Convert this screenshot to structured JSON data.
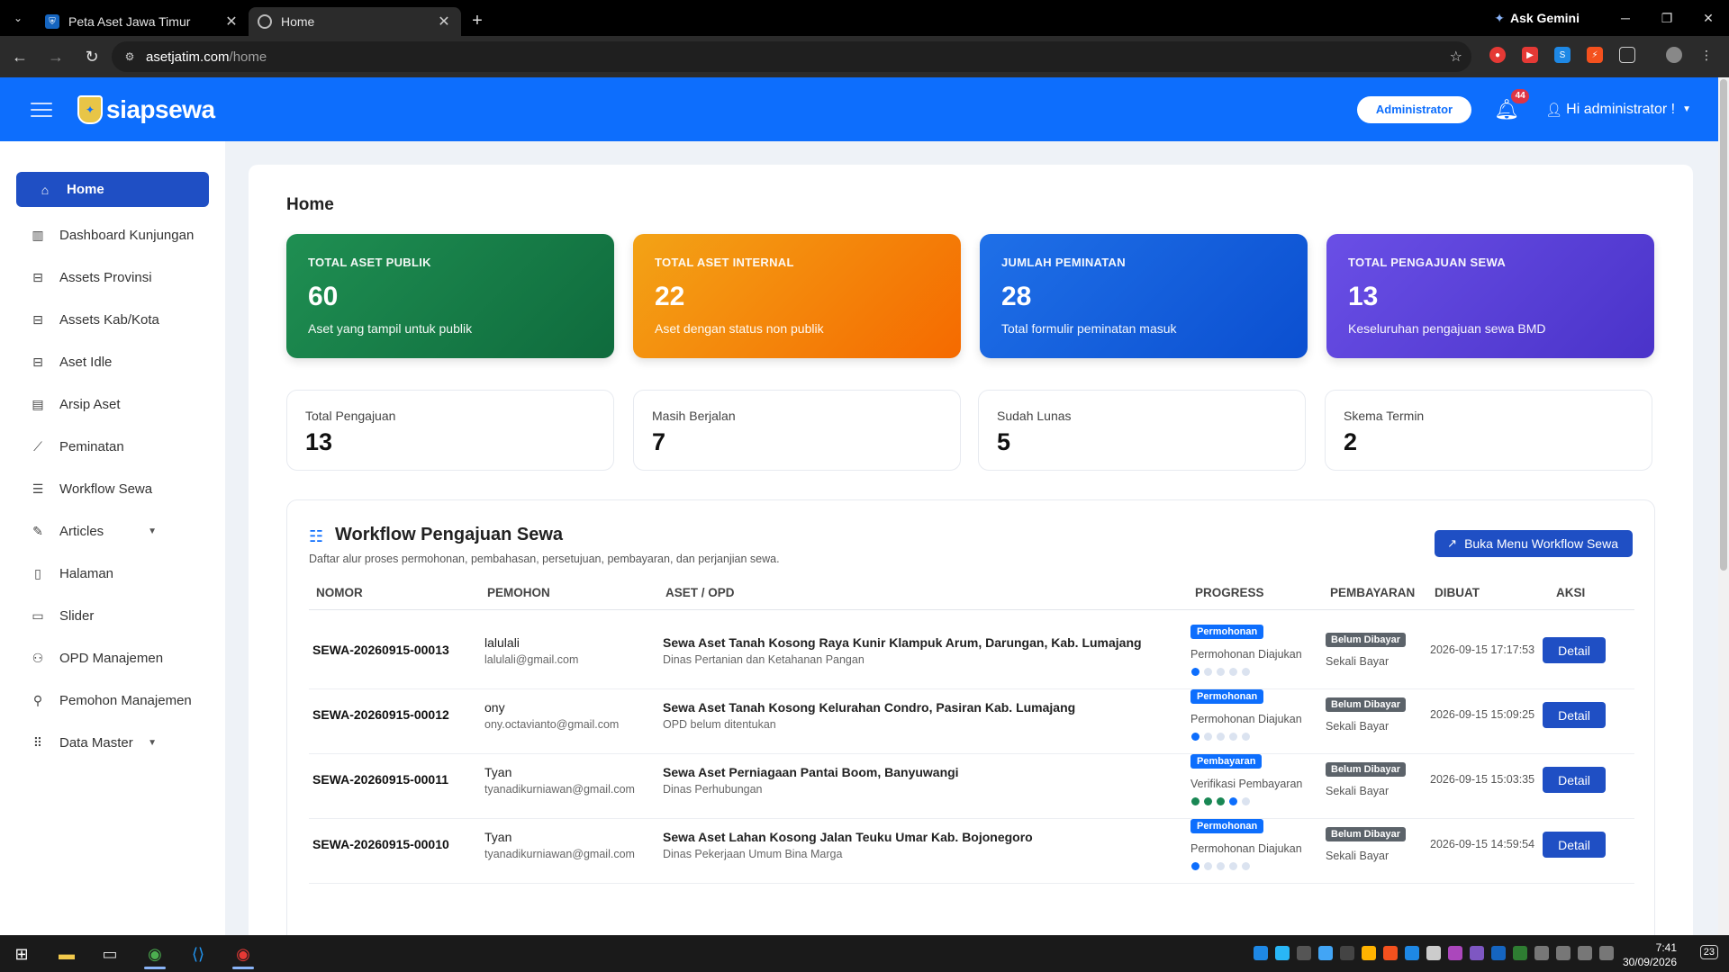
{
  "browser": {
    "tabs": [
      {
        "title": "Peta Aset Jawa Timur",
        "active": false
      },
      {
        "title": "Home",
        "active": true
      }
    ],
    "gemini_label": "Ask Gemini",
    "url_host": "asetjatim.com",
    "url_path": "/home"
  },
  "header": {
    "logo_text": "siapsewa",
    "role_pill": "Administrator",
    "notification_count": "44",
    "user_greeting": "Hi administrator !"
  },
  "sidebar": {
    "items": [
      {
        "label": "Home",
        "icon": "home-icon",
        "active": true
      },
      {
        "label": "Dashboard Kunjungan",
        "icon": "bar-chart-icon"
      },
      {
        "label": "Assets Provinsi",
        "icon": "box-icon"
      },
      {
        "label": "Assets Kab/Kota",
        "icon": "box-icon"
      },
      {
        "label": "Aset Idle",
        "icon": "box-icon"
      },
      {
        "label": "Arsip Aset",
        "icon": "archive-icon"
      },
      {
        "label": "Peminatan",
        "icon": "trend-icon"
      },
      {
        "label": "Workflow Sewa",
        "icon": "list-icon"
      },
      {
        "label": "Articles",
        "icon": "edit-icon",
        "has_submenu": true
      },
      {
        "label": "Halaman",
        "icon": "page-icon"
      },
      {
        "label": "Slider",
        "icon": "slider-icon"
      },
      {
        "label": "OPD Manajemen",
        "icon": "group-icon"
      },
      {
        "label": "Pemohon Manajemen",
        "icon": "user-icon"
      },
      {
        "label": "Data Master",
        "icon": "grid-icon",
        "has_submenu": true
      }
    ]
  },
  "main": {
    "title": "Home",
    "stat_cards": [
      {
        "label": "TOTAL ASET PUBLIK",
        "value": "60",
        "desc": "Aset yang tampil untuk publik",
        "color": "#1f8f52"
      },
      {
        "label": "TOTAL ASET INTERNAL",
        "value": "22",
        "desc": "Aset dengan status non publik",
        "color": "#f38a0c"
      },
      {
        "label": "JUMLAH PEMINATAN",
        "value": "28",
        "desc": "Total formulir peminatan masuk",
        "color": "#1560e0"
      },
      {
        "label": "TOTAL PENGAJUAN SEWA",
        "value": "13",
        "desc": "Keseluruhan pengajuan sewa BMD",
        "color": "#5a40d8"
      }
    ],
    "mini_cards": [
      {
        "label": "Total Pengajuan",
        "value": "13"
      },
      {
        "label": "Masih Berjalan",
        "value": "7"
      },
      {
        "label": "Sudah Lunas",
        "value": "5"
      },
      {
        "label": "Skema Termin",
        "value": "2"
      }
    ],
    "workflow": {
      "title": "Workflow Pengajuan Sewa",
      "subtitle": "Daftar alur proses permohonan, pembahasan, persetujuan, pembayaran, dan perjanjian sewa.",
      "button_label": "Buka Menu Workflow Sewa",
      "columns": [
        "NOMOR",
        "PEMOHON",
        "ASET / OPD",
        "PROGRESS",
        "PEMBAYARAN",
        "DIBUAT",
        "AKSI"
      ],
      "rows": [
        {
          "nomor": "SEWA-20260915-00013",
          "pemohon": "lalulali",
          "email": "lalulali@gmail.com",
          "aset": "Sewa Aset Tanah Kosong Raya Kunir Klampuk Arum, Darungan, Kab. Lumajang",
          "opd": "Dinas Pertanian dan Ketahanan Pangan",
          "stage": "Permohonan",
          "status": "Permohonan Diajukan",
          "progress_step": 1,
          "payment": "Belum Dibayar",
          "scheme": "Sekali Bayar",
          "created": "2026-09-15 17:17:53",
          "action": "Detail"
        },
        {
          "nomor": "SEWA-20260915-00012",
          "pemohon": "ony",
          "email": "ony.octavianto@gmail.com",
          "aset": "Sewa Aset Tanah Kosong Kelurahan Condro, Pasiran Kab. Lumajang",
          "opd": "OPD belum ditentukan",
          "stage": "Permohonan",
          "status": "Permohonan Diajukan",
          "progress_step": 1,
          "payment": "Belum Dibayar",
          "scheme": "Sekali Bayar",
          "created": "2026-09-15 15:09:25",
          "action": "Detail"
        },
        {
          "nomor": "SEWA-20260915-00011",
          "pemohon": "Tyan",
          "email": "tyanadikurniawan@gmail.com",
          "aset": "Sewa Aset Perniagaan Pantai Boom, Banyuwangi",
          "opd": "Dinas Perhubungan",
          "stage": "Pembayaran",
          "status": "Verifikasi Pembayaran",
          "progress_step": 4,
          "payment": "Belum Dibayar",
          "scheme": "Sekali Bayar",
          "created": "2026-09-15 15:03:35",
          "action": "Detail"
        },
        {
          "nomor": "SEWA-20260915-00010",
          "pemohon": "Tyan",
          "email": "tyanadikurniawan@gmail.com",
          "aset": "Sewa Aset Lahan Kosong Jalan Teuku Umar Kab. Bojonegoro",
          "opd": "Dinas Pekerjaan Umum Bina Marga",
          "stage": "Permohonan",
          "status": "Permohonan Diajukan",
          "progress_step": 1,
          "payment": "Belum Dibayar",
          "scheme": "Sekali Bayar",
          "created": "2026-09-15 14:59:54",
          "action": "Detail"
        }
      ]
    }
  },
  "taskbar": {
    "time": "7:41",
    "date": "30/09/2026",
    "notif": "23"
  }
}
